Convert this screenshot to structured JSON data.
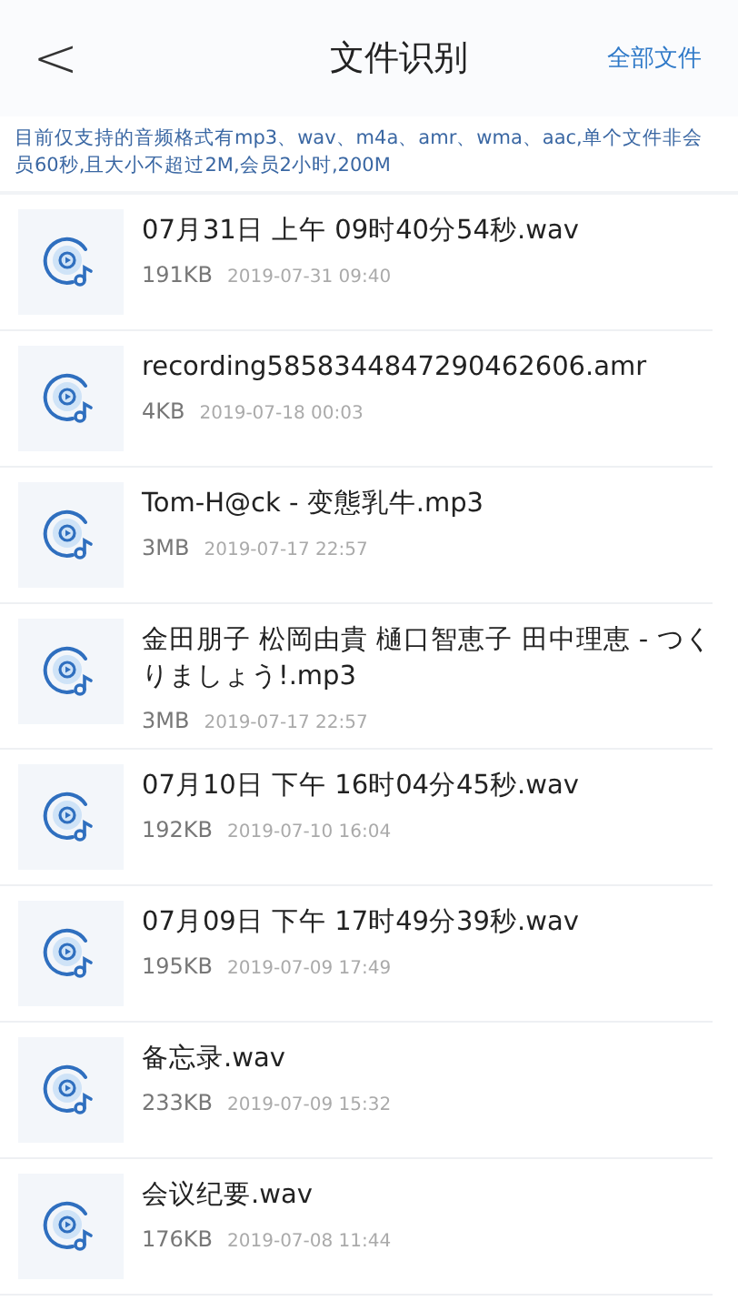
{
  "header": {
    "back": "<",
    "title": "文件识别",
    "action": "全部文件"
  },
  "notice": "目前仅支持的音频格式有mp3、wav、m4a、amr、wma、aac,单个文件非会员60秒,且大小不超过2M,会员2小时,200M",
  "files": [
    {
      "name": "07月31日 上午 09时40分54秒.wav",
      "size": "191KB",
      "date": "2019-07-31 09:40"
    },
    {
      "name": "recording5858344847290462606.amr",
      "size": "4KB",
      "date": "2019-07-18 00:03"
    },
    {
      "name": "Tom-H@ck - 变態乳牛.mp3",
      "size": "3MB",
      "date": "2019-07-17 22:57"
    },
    {
      "name": "金田朋子 松岡由貴 樋口智恵子 田中理恵 - つくりましょう!.mp3",
      "size": "3MB",
      "date": "2019-07-17 22:57"
    },
    {
      "name": "07月10日 下午 16时04分45秒.wav",
      "size": "192KB",
      "date": "2019-07-10 16:04"
    },
    {
      "name": "07月09日 下午 17时49分39秒.wav",
      "size": "195KB",
      "date": "2019-07-09 17:49"
    },
    {
      "name": "备忘录.wav",
      "size": "233KB",
      "date": "2019-07-09 15:32"
    },
    {
      "name": "会议纪要.wav",
      "size": "176KB",
      "date": "2019-07-08 11:44"
    }
  ]
}
